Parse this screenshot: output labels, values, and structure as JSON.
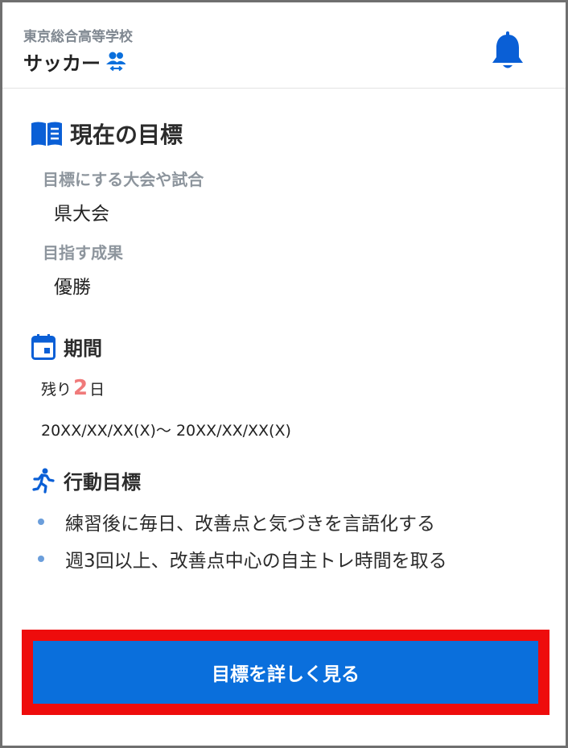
{
  "header": {
    "school_name": "東京総合高等学校",
    "club_name": "サッカー",
    "club_icon": "group-swap-icon",
    "notification_icon": "bell-icon"
  },
  "current_goal": {
    "title": "現在の目標",
    "icon": "book-icon",
    "tournament_label": "目標にする大会や試合",
    "tournament_value": "県大会",
    "result_label": "目指す成果",
    "result_value": "優勝"
  },
  "period": {
    "title": "期間",
    "icon": "calendar-icon",
    "remaining_prefix": "残り",
    "remaining_days": "2",
    "remaining_suffix": "日",
    "range": "20XX/XX/XX(X)〜 20XX/XX/XX(X)"
  },
  "action_goals": {
    "title": "行動目標",
    "icon": "running-icon",
    "items": [
      "練習後に毎日、改善点と気づきを言語化する",
      "週3回以上、改善点中心の自主トレ時間を取る"
    ]
  },
  "cta": {
    "label": "目標を詳しく見る"
  },
  "colors": {
    "primary": "#0a6fdc",
    "highlight": "#ee0c0c",
    "remaining_number": "#f07a7a",
    "bullet": "#6b9edb"
  }
}
